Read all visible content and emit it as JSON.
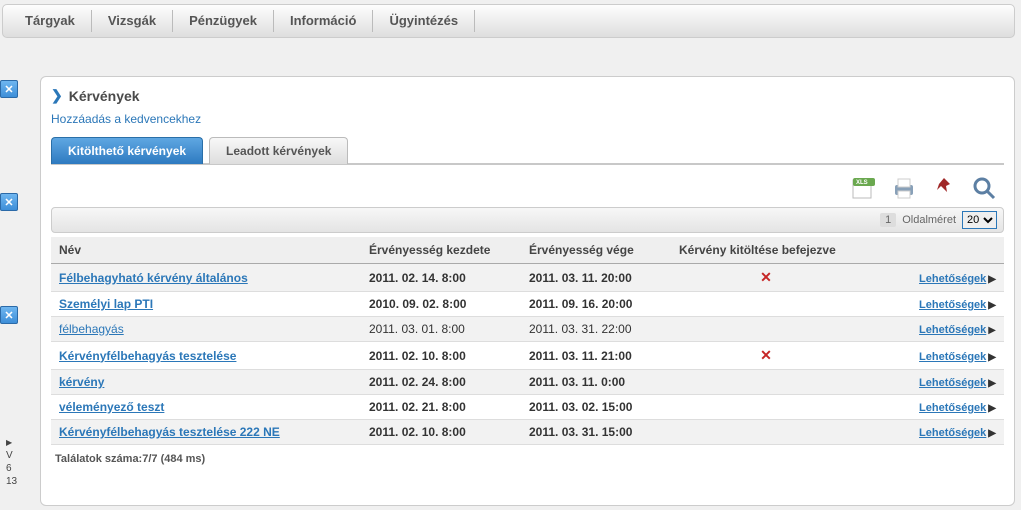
{
  "menu": [
    "Tárgyak",
    "Vizsgák",
    "Pénzügyek",
    "Információ",
    "Ügyintézés"
  ],
  "sidecounts": [
    "V",
    "6",
    "13"
  ],
  "page_title": "Kérvények",
  "fav_link": "Hozzáadás a kedvencekhez",
  "tabs": {
    "active": "Kitölthető kérvények",
    "other": "Leadott kérvények"
  },
  "pager": {
    "page": "1",
    "label": "Oldalméret",
    "value": "20",
    "options": [
      "20"
    ]
  },
  "headers": [
    "Név",
    "Érvényesség kezdete",
    "Érvényesség vége",
    "Kérvény kitöltése befejezve",
    ""
  ],
  "rows": [
    {
      "name": "Félbehagyható kérvény általános",
      "start": "2011. 02. 14. 8:00",
      "end": "2011. 03. 11. 20:00",
      "done": false,
      "bold": true,
      "opt": "Lehetőségek"
    },
    {
      "name": "Személyi lap PTI",
      "start": "2010. 09. 02. 8:00",
      "end": "2011. 09. 16. 20:00",
      "done": null,
      "bold": true,
      "opt": "Lehetőségek"
    },
    {
      "name": "félbehagyás",
      "start": "2011. 03. 01. 8:00",
      "end": "2011. 03. 31. 22:00",
      "done": null,
      "bold": false,
      "opt": "Lehetőségek"
    },
    {
      "name": "Kérvényfélbehagyás tesztelése",
      "start": "2011. 02. 10. 8:00",
      "end": "2011. 03. 11. 21:00",
      "done": false,
      "bold": true,
      "opt": "Lehetőségek"
    },
    {
      "name": "kérvény",
      "start": "2011. 02. 24. 8:00",
      "end": "2011. 03. 11. 0:00",
      "done": null,
      "bold": true,
      "opt": "Lehetőségek"
    },
    {
      "name": "véleményező teszt",
      "start": "2011. 02. 21. 8:00",
      "end": "2011. 03. 02. 15:00",
      "done": null,
      "bold": true,
      "opt": "Lehetőségek"
    },
    {
      "name": "Kérvényfélbehagyás tesztelése 222 NE",
      "start": "2011. 02. 10. 8:00",
      "end": "2011. 03. 31. 15:00",
      "done": null,
      "bold": true,
      "opt": "Lehetőségek"
    }
  ],
  "footer": "Találatok száma:7/7 (484 ms)"
}
